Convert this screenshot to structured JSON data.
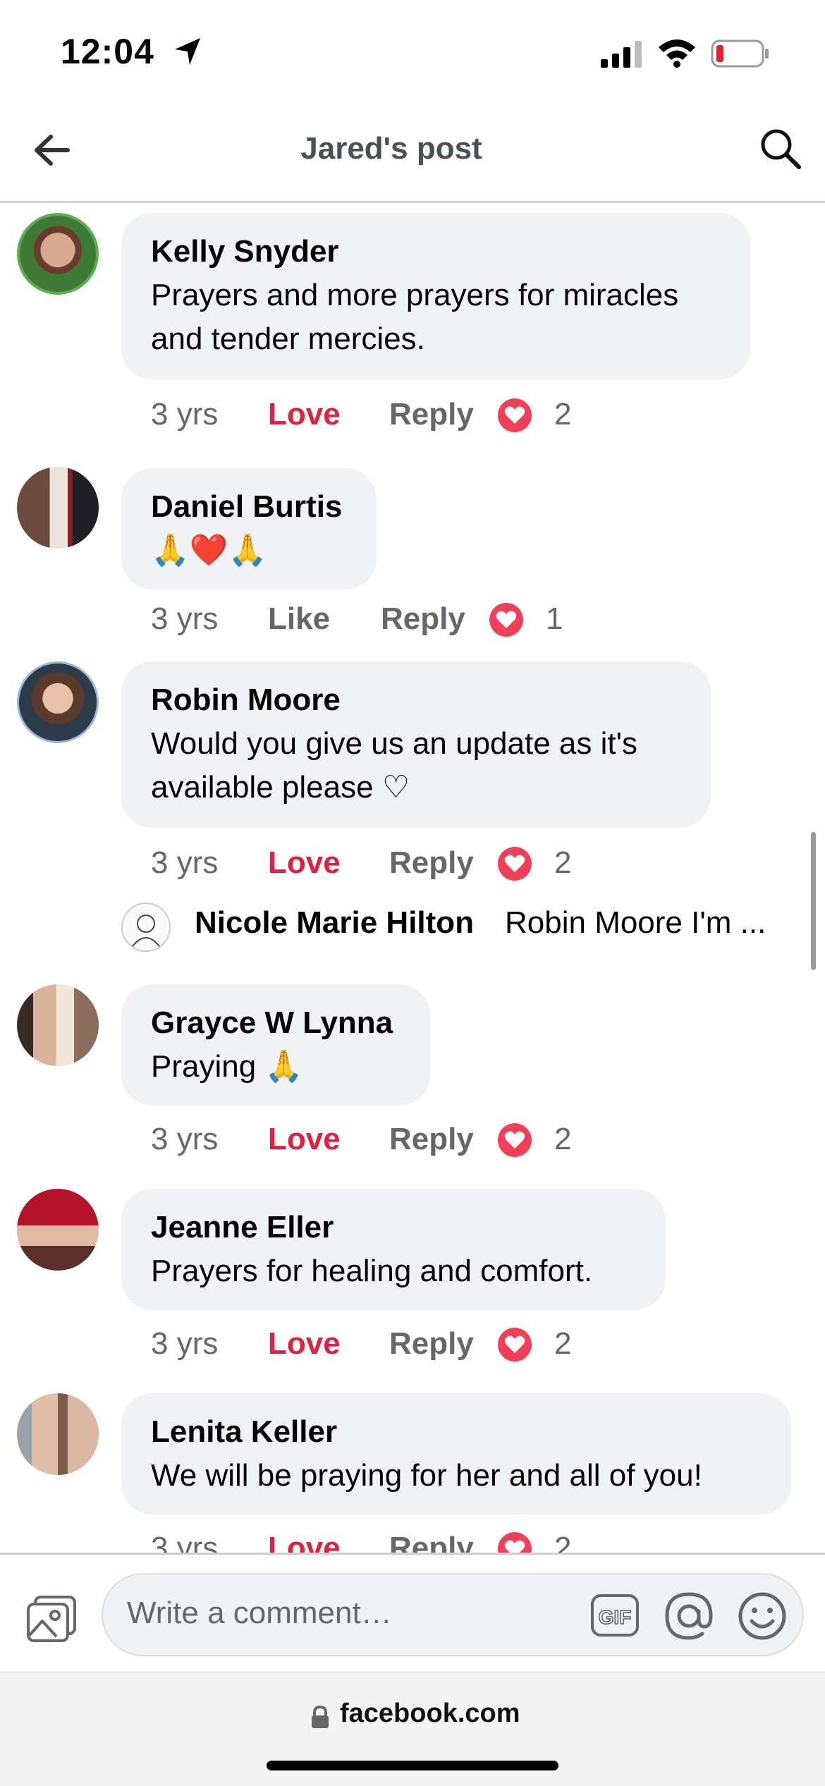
{
  "status_bar": {
    "time": "12:04"
  },
  "header": {
    "title": "Jared's post"
  },
  "comments": [
    {
      "author": "Kelly Snyder",
      "text": "Prayers and more prayers for miracles and tender mercies.",
      "time": "3 yrs",
      "reaction_label": "Love",
      "reply_label": "Reply",
      "reaction_count": "2"
    },
    {
      "author": "Daniel Burtis",
      "text": "🙏❤️🙏",
      "time": "3 yrs",
      "reaction_label": "Like",
      "reply_label": "Reply",
      "reaction_count": "1"
    },
    {
      "author": "Robin Moore",
      "text": "Would you give us an update as it's available please ♡",
      "time": "3 yrs",
      "reaction_label": "Love",
      "reply_label": "Reply",
      "reaction_count": "2",
      "reply_preview": {
        "author": "Nicole Marie Hilton",
        "text": "Robin Moore I'm ..."
      }
    },
    {
      "author": "Grayce W Lynna",
      "text": "Praying 🙏",
      "time": "3 yrs",
      "reaction_label": "Love",
      "reply_label": "Reply",
      "reaction_count": "2"
    },
    {
      "author": "Jeanne Eller",
      "text": "Prayers for healing and comfort.",
      "time": "3 yrs",
      "reaction_label": "Love",
      "reply_label": "Reply",
      "reaction_count": "2"
    },
    {
      "author": "Lenita Keller",
      "text": "We will be praying for her and all of you!",
      "time": "3 yrs",
      "reaction_label": "Love",
      "reply_label": "Reply",
      "reaction_count": "2"
    }
  ],
  "composer": {
    "placeholder": "Write a comment…",
    "gif_label": "GIF"
  },
  "browser": {
    "url": "facebook.com"
  },
  "colors": {
    "love": "#e41e3f",
    "meta": "#65676b",
    "bubble": "#f0f2f5",
    "heart_badge": "#f33e58"
  },
  "icons": [
    "location-arrow-icon",
    "signal-icon",
    "wifi-icon",
    "battery-icon",
    "back-arrow-icon",
    "search-icon",
    "heart-reaction-icon",
    "photo-icon",
    "gif-icon",
    "at-icon",
    "emoji-icon",
    "lock-icon"
  ]
}
